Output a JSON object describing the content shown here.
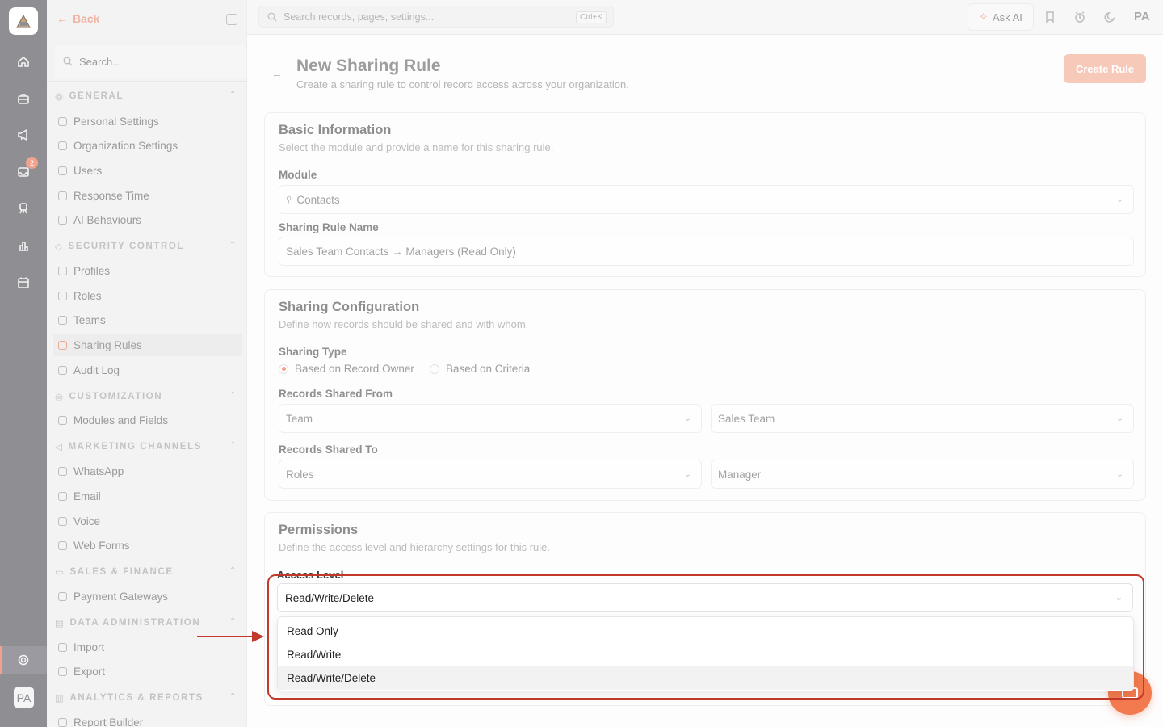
{
  "sidebar": {
    "back_label": "Back",
    "search_placeholder": "Search...",
    "sections": [
      {
        "title": "GENERAL",
        "items": [
          "Personal Settings",
          "Organization Settings",
          "Users",
          "Response Time",
          "AI Behaviours"
        ]
      },
      {
        "title": "SECURITY CONTROL",
        "items": [
          "Profiles",
          "Roles",
          "Teams",
          "Sharing Rules",
          "Audit Log"
        ]
      },
      {
        "title": "CUSTOMIZATION",
        "items": [
          "Modules and Fields"
        ]
      },
      {
        "title": "MARKETING CHANNELS",
        "items": [
          "WhatsApp",
          "Email",
          "Voice",
          "Web Forms"
        ]
      },
      {
        "title": "SALES & FINANCE",
        "items": [
          "Payment Gateways"
        ]
      },
      {
        "title": "DATA ADMINISTRATION",
        "items": [
          "Import",
          "Export"
        ]
      },
      {
        "title": "ANALYTICS & REPORTS",
        "items": [
          "Report Builder"
        ]
      }
    ],
    "active_item": "Sharing Rules"
  },
  "rail": {
    "badge_count": "2",
    "avatar_initials": "PA"
  },
  "topbar": {
    "search_placeholder": "Search records, pages, settings...",
    "search_shortcut": "Ctrl+K",
    "ask_ai_label": "Ask AI",
    "user_initials": "PA"
  },
  "page": {
    "title": "New Sharing Rule",
    "subtitle": "Create a sharing rule to control record access across your organization.",
    "create_button": "Create Rule"
  },
  "basic_info": {
    "title": "Basic Information",
    "subtitle": "Select the module and provide a name for this sharing rule.",
    "module_label": "Module",
    "module_value": "Contacts",
    "name_label": "Sharing Rule Name",
    "name_value": "Sales Team Contacts → Managers (Read Only)"
  },
  "sharing_config": {
    "title": "Sharing Configuration",
    "subtitle": "Define how records should be shared and with whom.",
    "type_label": "Sharing Type",
    "type_options": [
      "Based on Record Owner",
      "Based on Criteria"
    ],
    "type_selected": "Based on Record Owner",
    "from_label": "Records Shared From",
    "from_type": "Team",
    "from_value": "Sales Team",
    "to_label": "Records Shared To",
    "to_type": "Roles",
    "to_value": "Manager"
  },
  "permissions": {
    "title": "Permissions",
    "subtitle": "Define the access level and hierarchy settings for this rule.",
    "access_label": "Access Level",
    "access_value": "Read/Write/Delete",
    "access_options": [
      "Read Only",
      "Read/Write",
      "Read/Write/Delete"
    ],
    "access_selected": "Read/Write/Delete"
  },
  "colors": {
    "accent": "#f27a4e",
    "highlight_border": "#c0392b",
    "rail": "#8e8e93"
  }
}
